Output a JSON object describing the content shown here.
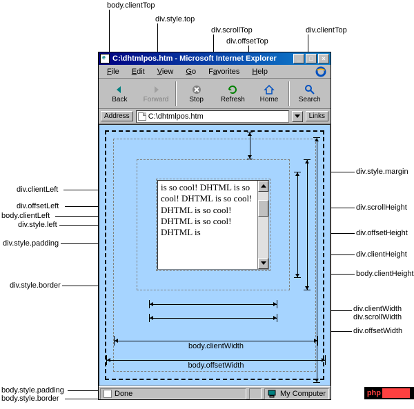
{
  "window": {
    "title": "C:\\dhtmlpos.htm - Microsoft Internet Explorer"
  },
  "menu": {
    "file": "File",
    "edit": "Edit",
    "view": "View",
    "go": "Go",
    "favorites": "Favorites",
    "help": "Help"
  },
  "toolbar": {
    "back": "Back",
    "forward": "Forward",
    "stop": "Stop",
    "refresh": "Refresh",
    "home": "Home",
    "search": "Search"
  },
  "addressbar": {
    "label": "Address",
    "value": "C:\\dhtmlpos.htm",
    "links": "Links"
  },
  "status": {
    "done": "Done",
    "zone": "My Computer"
  },
  "content": {
    "text": "is so cool! DHTML is so cool! DHTML is so cool! DHTML is so cool! DHTML is so cool! DHTML is"
  },
  "dimension_labels": {
    "body_clientWidth": "body.clientWidth",
    "body_offsetWidth": "body.offsetWidth"
  },
  "annotations": {
    "body_clientTop": "body.clientTop",
    "div_style_top": "div.style.top",
    "div_scrollTop": "div.scrollTop",
    "div_offsetTop": "div.offsetTop",
    "div_clientTop": "div.clientTop",
    "div_clientLeft": "div.clientLeft",
    "div_offsetLeft": "div.offsetLeft",
    "body_clientLeft": "body.clientLeft",
    "div_style_left": "div.style.left",
    "div_style_padding": "div.style.padding",
    "div_style_border": "div.style.border",
    "div_style_margin": "div.style.margin",
    "div_scrollHeight": "div.scrollHeight",
    "div_offsetHeight": "div.offsetHeight",
    "div_clientHeight": "div.clientHeight",
    "body_clientHeight": "body.clientHeight",
    "div_clientWidth": "div.clientWidth",
    "div_scrollWidth": "div.scrollWidth",
    "div_offsetWidth": "div.offsetWidth",
    "body_style_padding": "body.style.padding",
    "body_style_border": "body.style.border"
  },
  "watermark": "php"
}
